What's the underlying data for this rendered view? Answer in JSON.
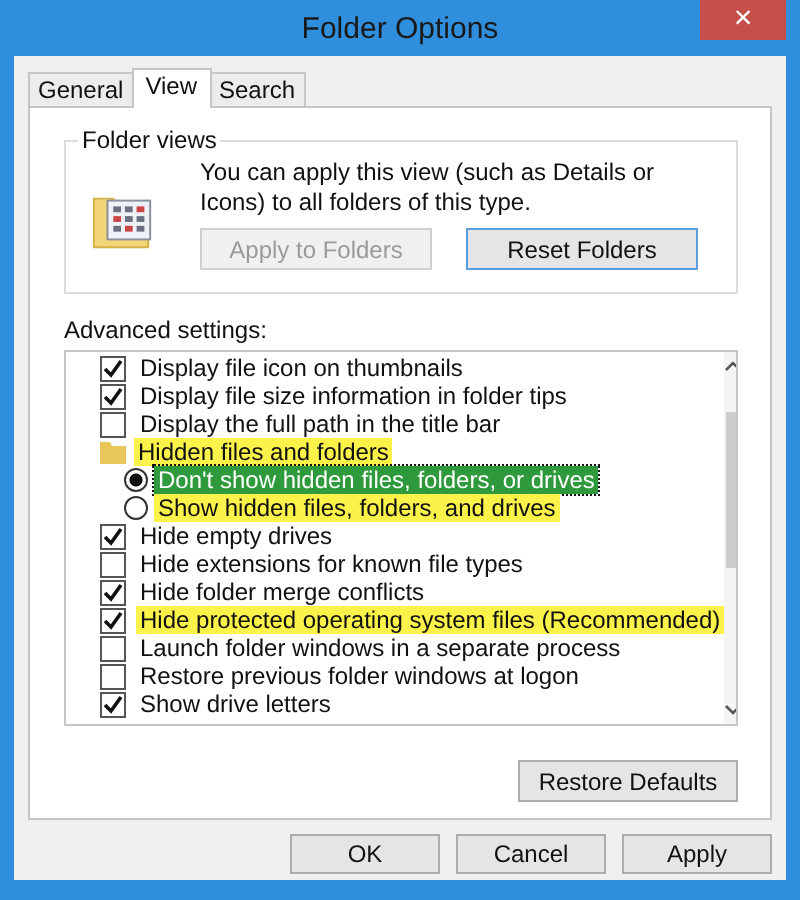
{
  "window": {
    "title": "Folder Options",
    "close": "×"
  },
  "tabs": [
    {
      "label": "General",
      "selected": false
    },
    {
      "label": "View",
      "selected": true
    },
    {
      "label": "Search",
      "selected": false
    }
  ],
  "folder_views": {
    "legend": "Folder views",
    "description": "You can apply this view (such as Details or Icons) to all folders of this type.",
    "buttons": [
      {
        "label": "Apply to Folders",
        "disabled": true
      },
      {
        "label": "Reset Folders",
        "disabled": false
      }
    ]
  },
  "advanced_settings": {
    "label": "Advanced settings:",
    "items": [
      {
        "kind": "checkbox",
        "label": "Display file icon on thumbnails",
        "checked": true,
        "highlighted": false
      },
      {
        "kind": "checkbox",
        "label": "Display file size information in folder tips",
        "checked": true,
        "highlighted": false
      },
      {
        "kind": "checkbox",
        "label": "Display the full path in the title bar",
        "checked": false,
        "highlighted": false
      },
      {
        "kind": "folder",
        "label": "Hidden files and folders",
        "highlighted": true
      },
      {
        "kind": "radio",
        "label": "Don't show hidden files, folders, or drives",
        "selected": true,
        "highlighted": true
      },
      {
        "kind": "radio",
        "label": "Show hidden files, folders, and drives",
        "selected": false,
        "highlighted": true
      },
      {
        "kind": "checkbox",
        "label": "Hide empty drives",
        "checked": true,
        "highlighted": false
      },
      {
        "kind": "checkbox",
        "label": "Hide extensions for known file types",
        "checked": false,
        "highlighted": false
      },
      {
        "kind": "checkbox",
        "label": "Hide folder merge conflicts",
        "checked": true,
        "highlighted": false
      },
      {
        "kind": "checkbox",
        "label": "Hide protected operating system files (Recommended)",
        "checked": true,
        "highlighted": true
      },
      {
        "kind": "checkbox",
        "label": "Launch folder windows in a separate process",
        "checked": false,
        "highlighted": false
      },
      {
        "kind": "checkbox",
        "label": "Restore previous folder windows at logon",
        "checked": false,
        "highlighted": false
      },
      {
        "kind": "checkbox",
        "label": "Show drive letters",
        "checked": true,
        "highlighted": false
      }
    ],
    "restore_button": "Restore Defaults"
  },
  "buttons": [
    "OK",
    "Cancel",
    "Apply"
  ]
}
